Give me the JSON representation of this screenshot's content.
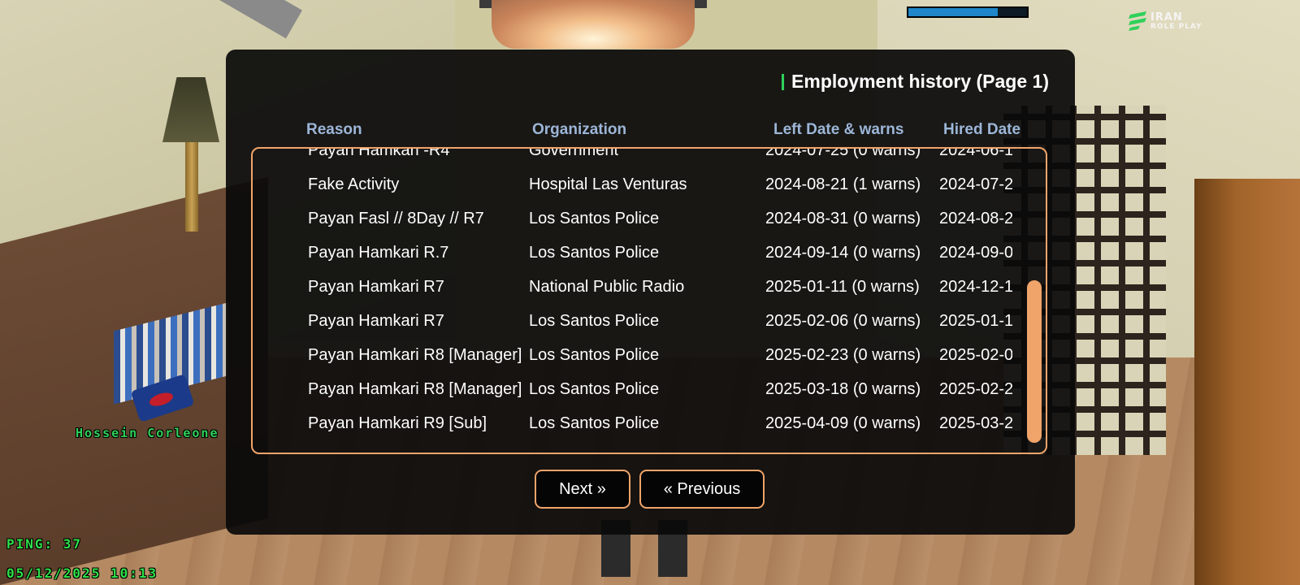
{
  "hud": {
    "health_bar_level": 0.75,
    "logo_line1": "IRAN",
    "logo_line2": "ROLE PLAY",
    "player_name": "Hossein Corleone",
    "ping": "PING: 37",
    "datetime": "05/12/2025 10:13"
  },
  "dialog": {
    "title": "Employment history (Page 1)",
    "columns": {
      "reason": "Reason",
      "organization": "Organization",
      "left_date": "Left Date & warns",
      "hired_date": "Hired Date"
    },
    "rows": [
      {
        "reason": "Payan Hamkari -R4",
        "organization": "Government",
        "left": "2024-07-25 (0 warns)",
        "hired": "2024-06-1"
      },
      {
        "reason": "Fake Activity",
        "organization": "Hospital Las Venturas",
        "left": "2024-08-21 (1 warns)",
        "hired": "2024-07-2"
      },
      {
        "reason": "Payan Fasl // 8Day // R7",
        "organization": "Los Santos Police",
        "left": "2024-08-31 (0 warns)",
        "hired": "2024-08-2"
      },
      {
        "reason": "Payan Hamkari R.7",
        "organization": "Los Santos Police",
        "left": "2024-09-14 (0 warns)",
        "hired": "2024-09-0"
      },
      {
        "reason": "Payan Hamkari R7",
        "organization": "National Public Radio",
        "left": "2025-01-11 (0 warns)",
        "hired": "2024-12-1"
      },
      {
        "reason": "Payan Hamkari R7",
        "organization": "Los Santos Police",
        "left": "2025-02-06 (0 warns)",
        "hired": "2025-01-1"
      },
      {
        "reason": "Payan Hamkari R8 [Manager]",
        "organization": "Los Santos Police",
        "left": "2025-02-23 (0 warns)",
        "hired": "2025-02-0"
      },
      {
        "reason": "Payan Hamkari R8 [Manager]",
        "organization": "Los Santos Police",
        "left": "2025-03-18 (0 warns)",
        "hired": "2025-02-2"
      },
      {
        "reason": "Payan Hamkari R9 [Sub]",
        "organization": "Los Santos Police",
        "left": "2025-04-09 (0 warns)",
        "hired": "2025-03-2"
      }
    ],
    "next_label": "Next »",
    "previous_label": "« Previous"
  },
  "colors": {
    "accent_border": "#f0a46a",
    "title_accent": "#2fd15a",
    "header_text": "#9db6d8",
    "hud_green": "#2fe04a"
  }
}
